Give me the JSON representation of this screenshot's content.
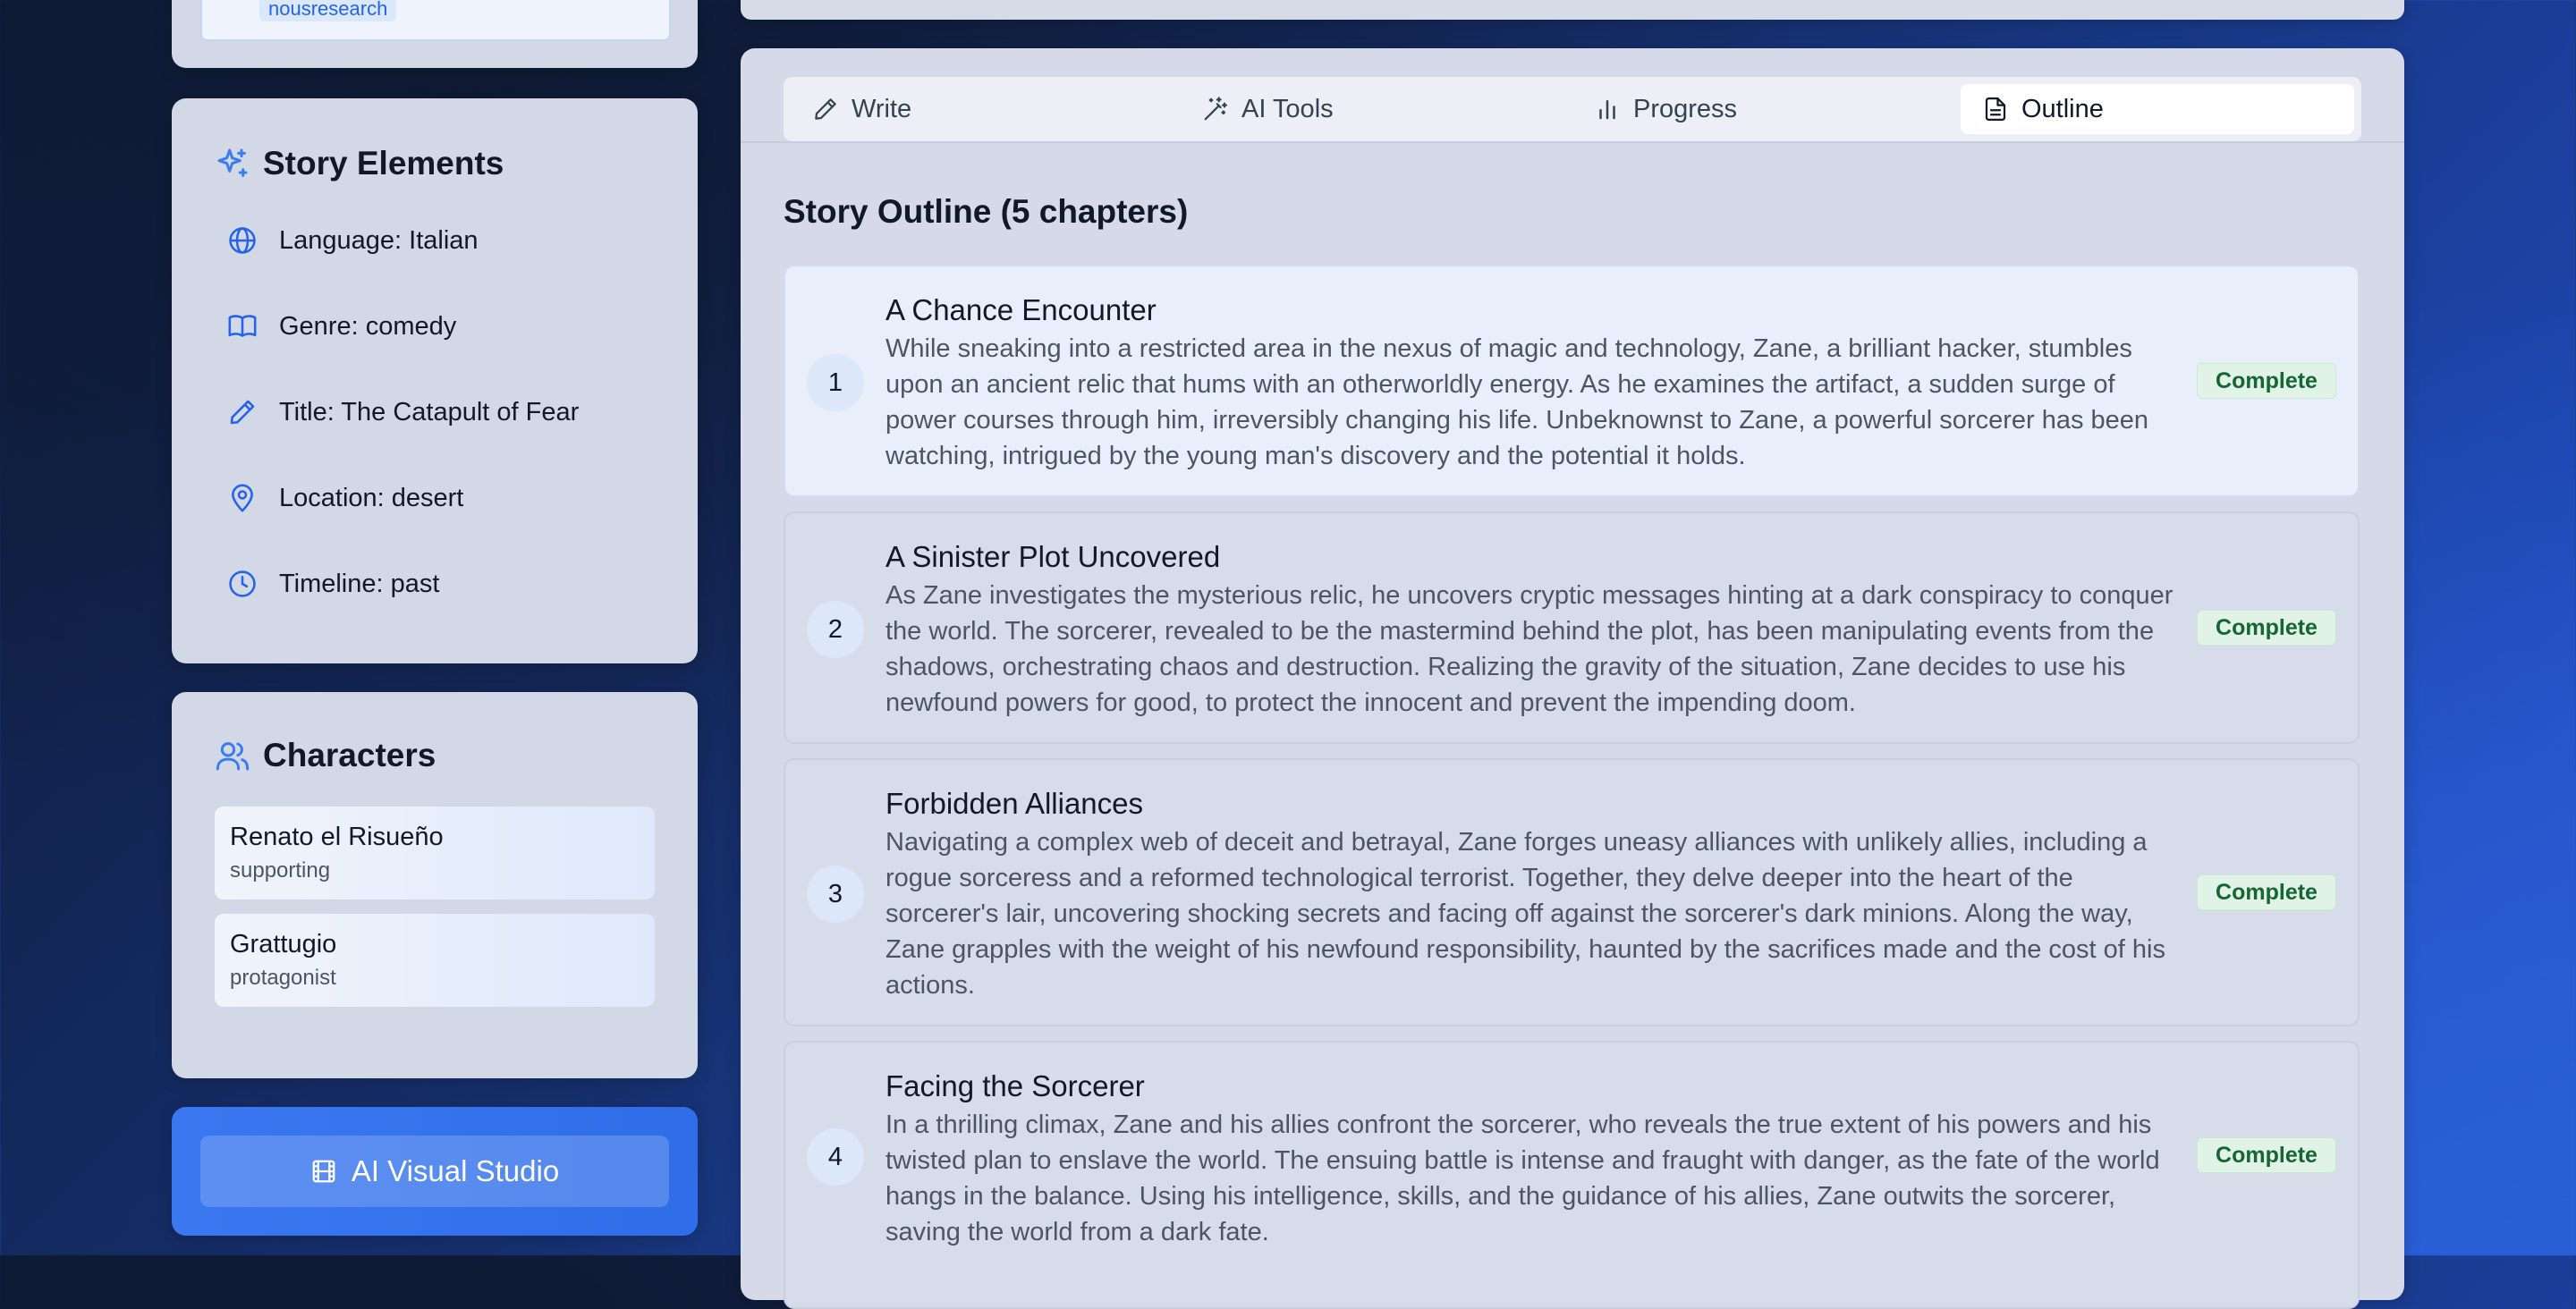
{
  "user_tag": "nousresearch",
  "story_elements": {
    "title": "Story Elements",
    "items": [
      {
        "icon": "globe-icon",
        "label": "Language: Italian"
      },
      {
        "icon": "book-open-icon",
        "label": "Genre: comedy"
      },
      {
        "icon": "pencil-icon",
        "label": "Title: The Catapult of Fear"
      },
      {
        "icon": "map-pin-icon",
        "label": "Location: desert"
      },
      {
        "icon": "clock-icon",
        "label": "Timeline: past"
      }
    ]
  },
  "characters": {
    "title": "Characters",
    "items": [
      {
        "name": "Renato el Risueño",
        "role": "supporting"
      },
      {
        "name": "Grattugio",
        "role": "protagonist"
      }
    ]
  },
  "visual_studio": {
    "label": "AI Visual Studio"
  },
  "tabs": [
    {
      "label": "Write",
      "icon": "pencil-icon"
    },
    {
      "label": "AI Tools",
      "icon": "magic-wand-icon"
    },
    {
      "label": "Progress",
      "icon": "bar-chart-icon"
    },
    {
      "label": "Outline",
      "icon": "document-icon",
      "active": true
    }
  ],
  "outline": {
    "title": "Story Outline (5 chapters)",
    "chapters": [
      {
        "number": "1",
        "title": "A Chance Encounter",
        "summary": "While sneaking into a restricted area in the nexus of magic and technology, Zane, a brilliant hacker, stumbles upon an ancient relic that hums with an otherworldly energy. As he examines the artifact, a sudden surge of power courses through him, irreversibly changing his life. Unbeknownst to Zane, a powerful sorcerer has been watching, intrigued by the young man's discovery and the potential it holds.",
        "status": "Complete"
      },
      {
        "number": "2",
        "title": "A Sinister Plot Uncovered",
        "summary": "As Zane investigates the mysterious relic, he uncovers cryptic messages hinting at a dark conspiracy to conquer the world. The sorcerer, revealed to be the mastermind behind the plot, has been manipulating events from the shadows, orchestrating chaos and destruction. Realizing the gravity of the situation, Zane decides to use his newfound powers for good, to protect the innocent and prevent the impending doom.",
        "status": "Complete"
      },
      {
        "number": "3",
        "title": "Forbidden Alliances",
        "summary": "Navigating a complex web of deceit and betrayal, Zane forges uneasy alliances with unlikely allies, including a rogue sorceress and a reformed technological terrorist. Together, they delve deeper into the heart of the sorcerer's lair, uncovering shocking secrets and facing off against the sorcerer's dark minions. Along the way, Zane grapples with the weight of his newfound responsibility, haunted by the sacrifices made and the cost of his actions.",
        "status": "Complete"
      },
      {
        "number": "4",
        "title": "Facing the Sorcerer",
        "summary": "In a thrilling climax, Zane and his allies confront the sorcerer, who reveals the true extent of his powers and his twisted plan to enslave the world. The ensuing battle is intense and fraught with danger, as the fate of the world hangs in the balance. Using his intelligence, skills, and the guidance of his allies, Zane outwits the sorcerer, saving the world from a dark fate.",
        "status": "Complete"
      }
    ]
  },
  "colors": {
    "accent": "#2563eb",
    "complete_bg": "#e1f3e6",
    "complete_text": "#166534"
  }
}
